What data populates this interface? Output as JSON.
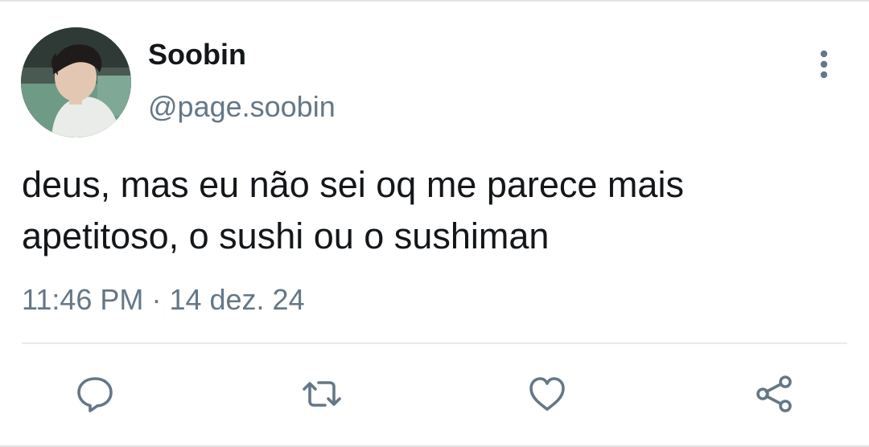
{
  "tweet": {
    "author": {
      "display_name": "Soobin",
      "handle": "@page.soobin",
      "avatar_icon": "profile-photo"
    },
    "text_line_1": "deus, mas eu não sei oq me parece mais",
    "text_line_2": "apetitoso, o sushi ou o sushiman",
    "time": "11:46 PM",
    "separator": "·",
    "date": "14 dez. 24"
  },
  "actions": {
    "reply_icon": "speech-bubble-icon",
    "retweet_icon": "retweet-arrows-icon",
    "like_icon": "heart-icon",
    "share_icon": "share-nodes-icon",
    "more_icon": "vertical-ellipsis-icon"
  },
  "colors": {
    "text_primary": "#14171a",
    "text_secondary": "#657786",
    "icon": "#657786",
    "divider": "#e6ecf0",
    "background": "#ffffff"
  }
}
